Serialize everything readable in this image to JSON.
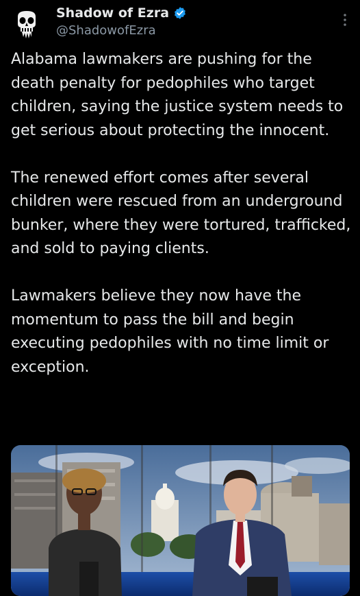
{
  "author": {
    "display_name": "Shadow of Ezra",
    "handle": "@ShadowofEzra",
    "verified": true
  },
  "icons": {
    "avatar": "skull-avatar-icon",
    "verified": "verified-badge-icon",
    "more": "more-options-icon"
  },
  "colors": {
    "background": "#000000",
    "text": "#e7e9ea",
    "secondary_text": "#8b98a5",
    "verified_blue": "#1d9bf0"
  },
  "tweet": {
    "paragraphs": [
      "Alabama lawmakers are pushing for the death penalty for pedophiles who target children, saying the justice system needs to get serious about protecting the innocent.",
      "The renewed effort comes after several children were rescued from an underground bunker, where they were tortured, trafficked, and sold to paying clients.",
      "Lawmakers believe they now have the momentum to pass the bill and begin executing pedophiles with no time limit or exception."
    ]
  },
  "media": {
    "kind": "news-broadcast-image"
  }
}
